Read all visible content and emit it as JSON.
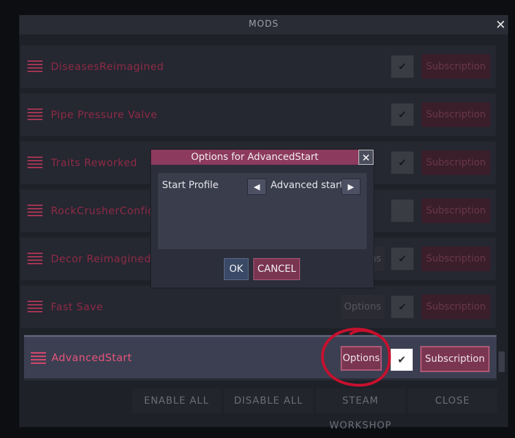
{
  "mods_window": {
    "title": "MODS",
    "close_glyph": "✕"
  },
  "mods": [
    {
      "name": "DiseasesReimagined",
      "enabled": true,
      "has_options": false
    },
    {
      "name": "Pipe Pressure Valve",
      "enabled": true,
      "has_options": false
    },
    {
      "name": "Traits Reworked",
      "enabled": true,
      "has_options": false
    },
    {
      "name": "RockCrusherConfig",
      "enabled": false,
      "has_options": false
    },
    {
      "name": "Decor Reimagined",
      "enabled": true,
      "has_options": true
    },
    {
      "name": "Fast Save",
      "enabled": true,
      "has_options": true
    }
  ],
  "row_labels": {
    "options": "Options",
    "subscription": "Subscription",
    "check_glyph": "✔"
  },
  "active_mod": {
    "name": "AdvancedStart",
    "options_label": "Options",
    "check_glyph": "✔",
    "subscription_label": "Subscription",
    "enabled": true
  },
  "footer": {
    "enable_all": "ENABLE ALL",
    "disable_all": "DISABLE ALL",
    "steam_workshop": "STEAM WORKSHOP",
    "close": "CLOSE"
  },
  "dialog": {
    "title": "Options for AdvancedStart",
    "close_glyph": "✕",
    "setting_label": "Start Profile",
    "prev_glyph": "◀",
    "setting_value": "Advanced start",
    "next_glyph": "▶",
    "ok_label": "OK",
    "cancel_label": "CANCEL"
  },
  "colors": {
    "accent": "#8c3a5d",
    "mod_name_dim": "#8e2b45",
    "mod_name_active": "#e8557a",
    "annotation": "#c8102e"
  },
  "icons": {
    "drag_handle": "drag-handle-icon",
    "close": "close-icon",
    "check": "checkmark-icon",
    "prev": "left-arrow-icon",
    "next": "right-arrow-icon"
  }
}
